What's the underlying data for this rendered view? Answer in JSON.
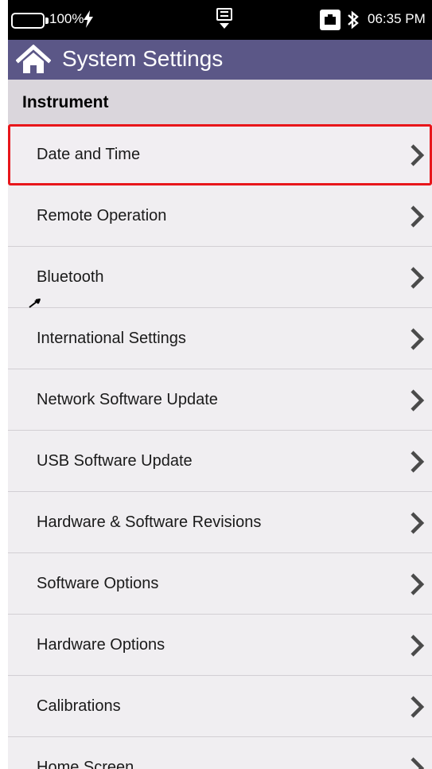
{
  "status_bar": {
    "battery_percent": "100%",
    "clock": "06:35 PM",
    "icons": [
      "battery-icon",
      "charging-bolt-icon",
      "usb-icon",
      "lan-icon",
      "bluetooth-icon"
    ]
  },
  "title_bar": {
    "title": "System Settings",
    "home_icon": "home-icon"
  },
  "section": {
    "title": "Instrument"
  },
  "list_items": [
    {
      "label": "Date and Time",
      "highlighted": true
    },
    {
      "label": "Remote Operation"
    },
    {
      "label": "Bluetooth"
    },
    {
      "label": "International Settings"
    },
    {
      "label": "Network Software Update"
    },
    {
      "label": "USB Software Update"
    },
    {
      "label": "Hardware & Software Revisions"
    },
    {
      "label": "Software Options"
    },
    {
      "label": "Hardware Options"
    },
    {
      "label": "Calibrations"
    },
    {
      "label": "Home Screen"
    }
  ],
  "colors": {
    "title_bar": "#5b5787",
    "section_header": "#dad6dc",
    "list_background": "#f0eef1",
    "highlight_border": "#e8161b",
    "chevron": "#4a4a4a"
  }
}
